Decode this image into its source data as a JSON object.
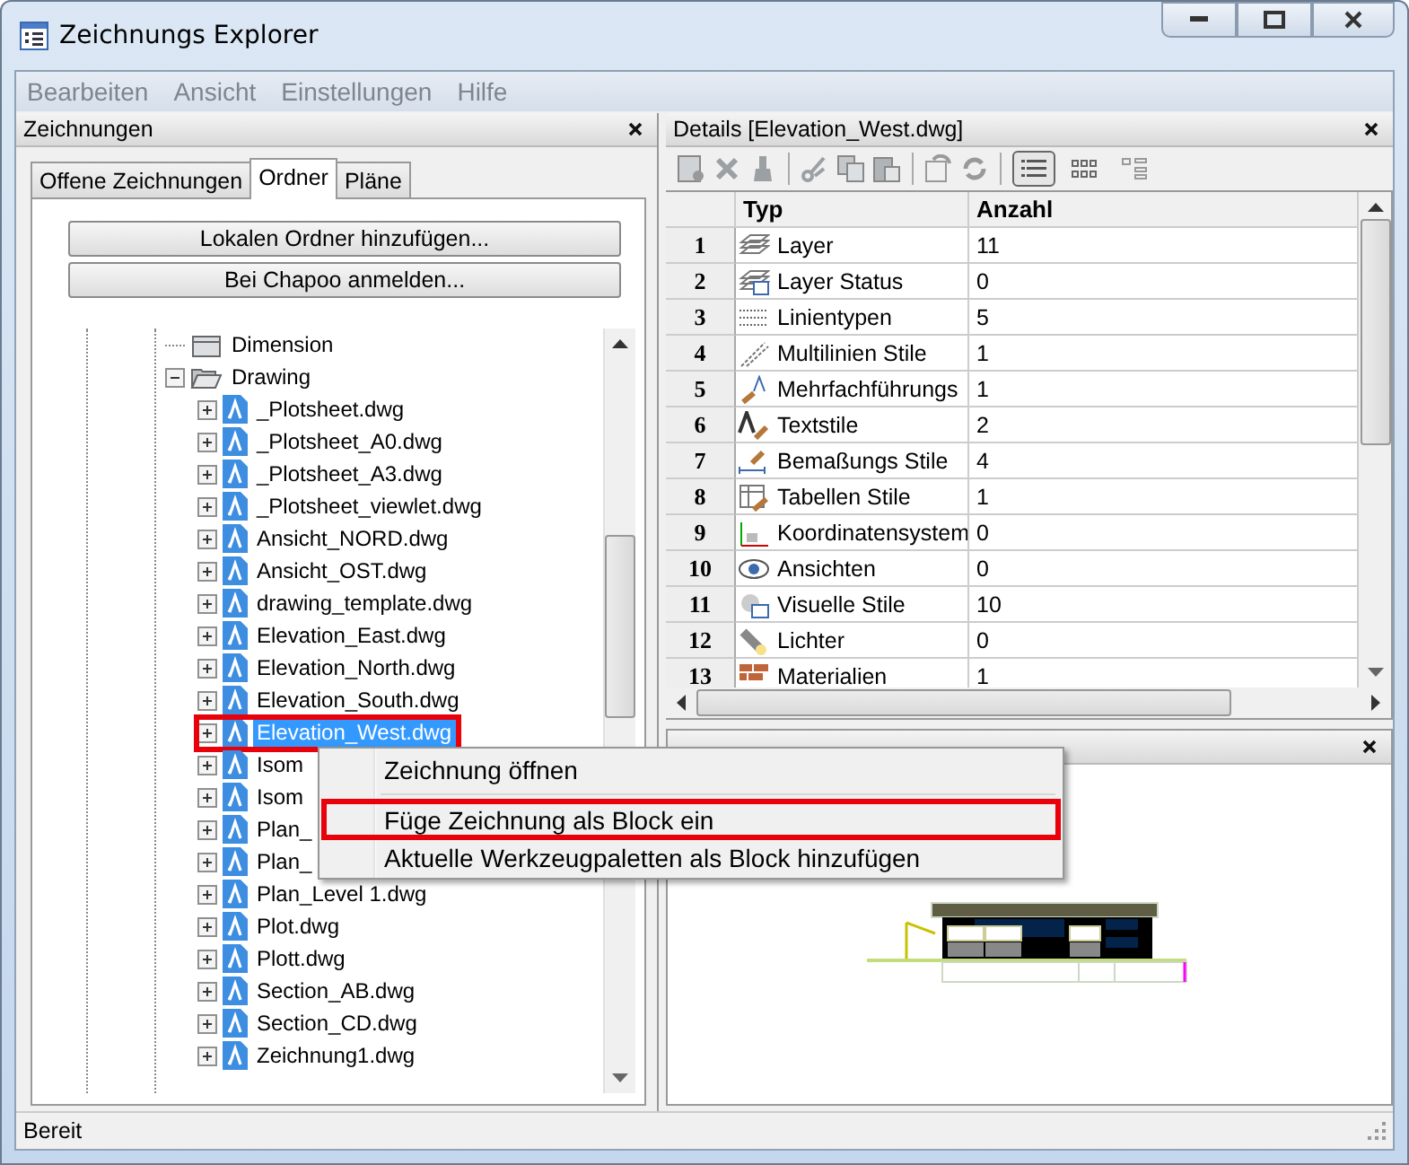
{
  "window": {
    "title": "Zeichnungs Explorer"
  },
  "menu": [
    {
      "label": "Bearbeiten",
      "disabled": true
    },
    {
      "label": "Ansicht",
      "disabled": true
    },
    {
      "label": "Einstellungen",
      "disabled": true
    },
    {
      "label": "Hilfe",
      "disabled": true
    }
  ],
  "left_panel": {
    "title": "Zeichnungen",
    "tabs": [
      {
        "label": "Offene Zeichnungen",
        "selected": false
      },
      {
        "label": "Ordner",
        "selected": true
      },
      {
        "label": "Pläne",
        "selected": false
      }
    ],
    "buttons": [
      "Lokalen Ordner hinzufügen...",
      "Bei Chapoo anmelden..."
    ],
    "tree": [
      {
        "label": "Dimension",
        "kind": "folder",
        "selected": false,
        "annotated": false
      },
      {
        "label": "Drawing",
        "kind": "folder",
        "expanded": true,
        "selected": false,
        "annotated": false,
        "children": [
          {
            "label": "_Plotsheet.dwg",
            "kind": "file",
            "expanded": false,
            "selected": false,
            "annotated": false
          },
          {
            "label": "_Plotsheet_A0.dwg",
            "kind": "file",
            "expanded": false,
            "selected": false,
            "annotated": false
          },
          {
            "label": "_Plotsheet_A3.dwg",
            "kind": "file",
            "expanded": false,
            "selected": false,
            "annotated": false
          },
          {
            "label": "_Plotsheet_viewlet.dwg",
            "kind": "file",
            "expanded": false,
            "selected": false,
            "annotated": false
          },
          {
            "label": "Ansicht_NORD.dwg",
            "kind": "file",
            "expanded": false,
            "selected": false,
            "annotated": false
          },
          {
            "label": "Ansicht_OST.dwg",
            "kind": "file",
            "expanded": false,
            "selected": false,
            "annotated": false
          },
          {
            "label": "drawing_template.dwg",
            "kind": "file",
            "expanded": false,
            "selected": false,
            "annotated": false
          },
          {
            "label": "Elevation_East.dwg",
            "kind": "file",
            "expanded": false,
            "selected": false,
            "annotated": false
          },
          {
            "label": "Elevation_North.dwg",
            "kind": "file",
            "expanded": false,
            "selected": false,
            "annotated": false
          },
          {
            "label": "Elevation_South.dwg",
            "kind": "file",
            "expanded": false,
            "selected": false,
            "annotated": false
          },
          {
            "label": "Elevation_West.dwg",
            "kind": "file",
            "expanded": false,
            "selected": true,
            "annotated": true
          },
          {
            "label": "Isom",
            "kind": "file",
            "expanded": false,
            "selected": false,
            "annotated": false
          },
          {
            "label": "Isom",
            "kind": "file",
            "expanded": false,
            "selected": false,
            "annotated": false
          },
          {
            "label": "Plan_",
            "kind": "file",
            "expanded": false,
            "selected": false,
            "annotated": false
          },
          {
            "label": "Plan_",
            "kind": "file",
            "expanded": false,
            "selected": false,
            "annotated": false
          },
          {
            "label": "Plan_Level 1.dwg",
            "kind": "file",
            "expanded": false,
            "selected": false,
            "annotated": false
          },
          {
            "label": "Plot.dwg",
            "kind": "file",
            "expanded": false,
            "selected": false,
            "annotated": false
          },
          {
            "label": "Plott.dwg",
            "kind": "file",
            "expanded": false,
            "selected": false,
            "annotated": false
          },
          {
            "label": "Section_AB.dwg",
            "kind": "file",
            "expanded": false,
            "selected": false,
            "annotated": false
          },
          {
            "label": "Section_CD.dwg",
            "kind": "file",
            "expanded": false,
            "selected": false,
            "annotated": false
          },
          {
            "label": "Zeichnung1.dwg",
            "kind": "file",
            "expanded": false,
            "selected": false,
            "annotated": false
          }
        ]
      }
    ]
  },
  "details_panel": {
    "title": "Details [Elevation_West.dwg]",
    "view_modes": [
      {
        "selected": true
      },
      {
        "selected": false
      },
      {
        "selected": false
      }
    ],
    "table": {
      "columns": [
        "Typ",
        "Anzahl"
      ],
      "rows": [
        {
          "number": "1",
          "type": "Layer",
          "count": "11"
        },
        {
          "number": "2",
          "type": "Layer Status",
          "count": "0"
        },
        {
          "number": "3",
          "type": "Linientypen",
          "count": "5"
        },
        {
          "number": "4",
          "type": "Multilinien Stile",
          "count": "1"
        },
        {
          "number": "5",
          "type": "Mehrfachführungs",
          "count": "1"
        },
        {
          "number": "6",
          "type": "Textstile",
          "count": "2"
        },
        {
          "number": "7",
          "type": "Bemaßungs Stile",
          "count": "4"
        },
        {
          "number": "8",
          "type": "Tabellen Stile",
          "count": "1"
        },
        {
          "number": "9",
          "type": "Koordinatensystem",
          "count": "0"
        },
        {
          "number": "10",
          "type": "Ansichten",
          "count": "0"
        },
        {
          "number": "11",
          "type": "Visuelle Stile",
          "count": "10"
        },
        {
          "number": "12",
          "type": "Lichter",
          "count": "0"
        },
        {
          "number": "13",
          "type": "Materialien",
          "count": "1"
        }
      ]
    }
  },
  "context_menu": [
    {
      "label": "Zeichnung öffnen",
      "annotated": false
    },
    {
      "label": "Füge Zeichnung als Block ein",
      "annotated": true
    },
    {
      "label": "Aktuelle Werkzeugpaletten als Block hinzufügen",
      "annotated": false
    }
  ],
  "status_bar": {
    "text": "Bereit"
  }
}
